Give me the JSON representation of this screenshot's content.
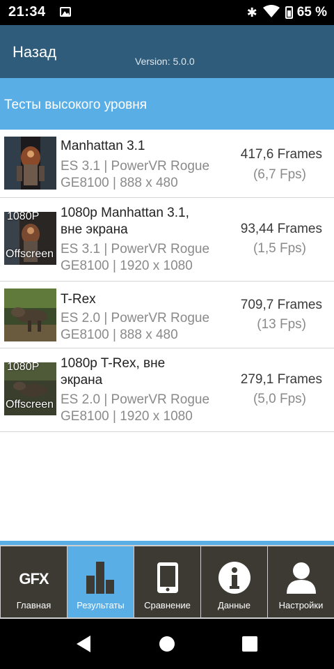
{
  "status_bar": {
    "time": "21:34",
    "battery": "65 %",
    "icons": [
      "image-icon",
      "bluetooth-icon",
      "wifi-icon",
      "battery-icon"
    ]
  },
  "header": {
    "back_label": "Назад",
    "version": "Version: 5.0.0",
    "color": "#2f5c7a"
  },
  "section": {
    "title": "Тесты высокого уровня",
    "color": "#5aaee6"
  },
  "tests": [
    {
      "title_lines": [
        "Manhattan 3.1"
      ],
      "sub_lines": [
        "ES 3.1 | PowerVR Rogue",
        "GE8100 | 888 x 480"
      ],
      "frames": "417,6 Frames",
      "fps": "(6,7 Fps)",
      "thumb_label_top": "",
      "thumb_label_bottom": ""
    },
    {
      "title_lines": [
        "1080p Manhattan 3.1,",
        "вне экрана"
      ],
      "sub_lines": [
        "ES 3.1 | PowerVR Rogue",
        "GE8100 | 1920 x 1080"
      ],
      "frames": "93,44 Frames",
      "fps": "(1,5 Fps)",
      "thumb_label_top": "1080P",
      "thumb_label_bottom": "Offscreen"
    },
    {
      "title_lines": [
        "T-Rex"
      ],
      "sub_lines": [
        "ES 2.0 | PowerVR Rogue",
        "GE8100 | 888 x 480"
      ],
      "frames": "709,7 Frames",
      "fps": "(13 Fps)",
      "thumb_label_top": "",
      "thumb_label_bottom": ""
    },
    {
      "title_lines": [
        "1080p T-Rex, вне",
        "экрана"
      ],
      "sub_lines": [
        "ES 2.0 | PowerVR Rogue",
        "GE8100 | 1920 x 1080"
      ],
      "frames": "279,1 Frames",
      "fps": "(5,0 Fps)",
      "thumb_label_top": "1080P",
      "thumb_label_bottom": "Offscreen"
    }
  ],
  "bottom_nav": {
    "tabs": [
      {
        "label": "Главная",
        "icon": "gfx-logo-icon",
        "icon_text": "GFX",
        "active": false
      },
      {
        "label": "Результаты",
        "icon": "bar-chart-icon",
        "active": true
      },
      {
        "label": "Сравнение",
        "icon": "phone-icon",
        "active": false
      },
      {
        "label": "Данные",
        "icon": "info-icon",
        "active": false
      },
      {
        "label": "Настройки",
        "icon": "user-icon",
        "active": false
      }
    ]
  }
}
